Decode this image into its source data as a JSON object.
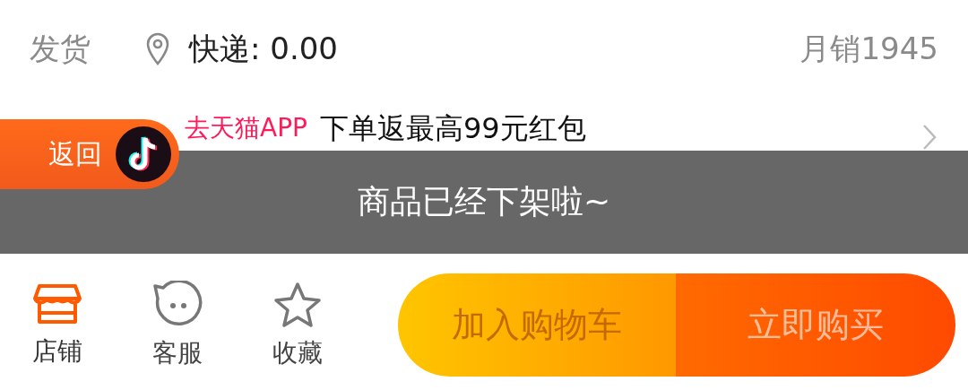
{
  "shipping": {
    "label": "发货",
    "fee": "快递: 0.00",
    "monthly_sales": "月销1945"
  },
  "promo": {
    "highlight": "去天猫APP",
    "text": "下单返最高99元红包"
  },
  "back_badge": {
    "label": "返回"
  },
  "toast": {
    "message": "商品已经下架啦~"
  },
  "bottom_bar": {
    "icons": [
      {
        "kind": "store",
        "label": "店铺",
        "selected": true
      },
      {
        "kind": "service",
        "label": "客服",
        "selected": false
      },
      {
        "kind": "favorite",
        "label": "收藏",
        "selected": false
      }
    ],
    "buttons": [
      {
        "kind": "cart",
        "label": "加入购物车",
        "disabled": true
      },
      {
        "kind": "buy",
        "label": "立即购买",
        "disabled": true
      }
    ]
  }
}
